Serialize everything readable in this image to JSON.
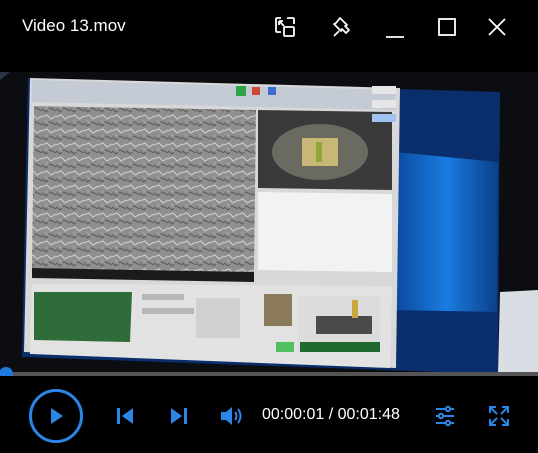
{
  "window": {
    "title": "Video 13.mov"
  },
  "player": {
    "current_time": "00:00:01",
    "separator": " / ",
    "duration": "00:01:48",
    "progress_fraction": 0.0093
  },
  "colors": {
    "accent": "#1e7be0",
    "background": "#000000"
  },
  "icons": {
    "titlebar": [
      "picture-in-picture-icon",
      "pin-icon",
      "minimize-icon",
      "maximize-icon",
      "close-icon"
    ],
    "controls": [
      "play-icon",
      "previous-icon",
      "next-icon",
      "volume-icon",
      "settings-sliders-icon",
      "fullscreen-icon"
    ]
  }
}
